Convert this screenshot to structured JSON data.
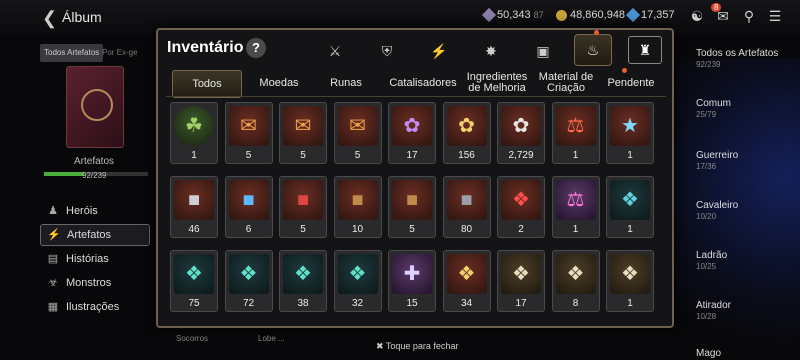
{
  "header": {
    "back_icon": "back-arrow-icon",
    "title": "Álbum",
    "resources": [
      {
        "icon": "stamina-icon",
        "value": "50,343",
        "sub": "87"
      },
      {
        "icon": "gold-icon",
        "value": "48,860,948"
      },
      {
        "icon": "skystone-icon",
        "value": "17,357"
      }
    ],
    "mail_badge": "8"
  },
  "left": {
    "tab_all": "Todos Artefatos",
    "tab_other": "Por Ex-ge",
    "label": "Artefatos",
    "count": "92/239",
    "progress": 0.385,
    "nav": [
      "Heróis",
      "Artefatos",
      "Histórias",
      "Monstros",
      "Ilustrações"
    ]
  },
  "right": {
    "items": [
      {
        "name": "Todos os Artefatos",
        "count": "92/239"
      },
      {
        "name": "Comum",
        "count": "25/79"
      },
      {
        "name": "Guerreiro",
        "count": "17/36"
      },
      {
        "name": "Cavaleiro",
        "count": "10/20"
      },
      {
        "name": "Ladrão",
        "count": "10/25"
      },
      {
        "name": "Atirador",
        "count": "10/28"
      },
      {
        "name": "Mago",
        "count": ""
      }
    ]
  },
  "modal": {
    "title": "Inventário",
    "help": "?",
    "tabs": [
      "Todos",
      "Moedas",
      "Runas",
      "Catalisadores",
      "Ingredientes de Melhoria",
      "Material de Criação",
      "Pendente"
    ],
    "category_icons": [
      "weapon-icon",
      "shield-off-icon",
      "lightning-icon",
      "spiky-catalyst-icon",
      "cube-icon",
      "bag-icon",
      "castle-icon"
    ],
    "items": [
      {
        "icon": "pet-icon",
        "qty": "1"
      },
      {
        "icon": "scroll-icon",
        "qty": "5"
      },
      {
        "icon": "scroll-icon",
        "qty": "5"
      },
      {
        "icon": "scroll-icon",
        "qty": "5"
      },
      {
        "icon": "purple-crystal-icon",
        "qty": "17"
      },
      {
        "icon": "gold-crystal-icon",
        "qty": "156"
      },
      {
        "icon": "silver-crystal-icon",
        "qty": "2,729"
      },
      {
        "icon": "potion-icon",
        "qty": "1"
      },
      {
        "icon": "star-icon",
        "qty": "1"
      },
      {
        "icon": "silver-chest-icon",
        "qty": "46"
      },
      {
        "icon": "blue-chest-icon",
        "qty": "6"
      },
      {
        "icon": "red-chest-icon",
        "qty": "5"
      },
      {
        "icon": "wood-chest-icon",
        "qty": "10"
      },
      {
        "icon": "wood-chest-icon",
        "qty": "5"
      },
      {
        "icon": "dark-chest-icon",
        "qty": "80"
      },
      {
        "icon": "red-rune-icon",
        "qty": "2"
      },
      {
        "icon": "pink-potion-icon",
        "qty": "1"
      },
      {
        "icon": "blue-rune-icon",
        "qty": "1"
      },
      {
        "icon": "teal-rune-icon",
        "qty": "75"
      },
      {
        "icon": "teal-rune-icon",
        "qty": "72"
      },
      {
        "icon": "teal-rune-icon",
        "qty": "38"
      },
      {
        "icon": "teal-rune-icon",
        "qty": "32"
      },
      {
        "icon": "purple-rune-icon",
        "qty": "15"
      },
      {
        "icon": "gold-rune-icon",
        "qty": "34"
      },
      {
        "icon": "sand-rune-icon",
        "qty": "17"
      },
      {
        "icon": "sand-rune-icon",
        "qty": "8"
      },
      {
        "icon": "sand-rune-icon",
        "qty": "1"
      }
    ]
  },
  "footer": {
    "close": "Toque para fechar",
    "close_icon": "x-icon",
    "partial_left": "Socorros",
    "partial_mid": "Lobe ..."
  }
}
